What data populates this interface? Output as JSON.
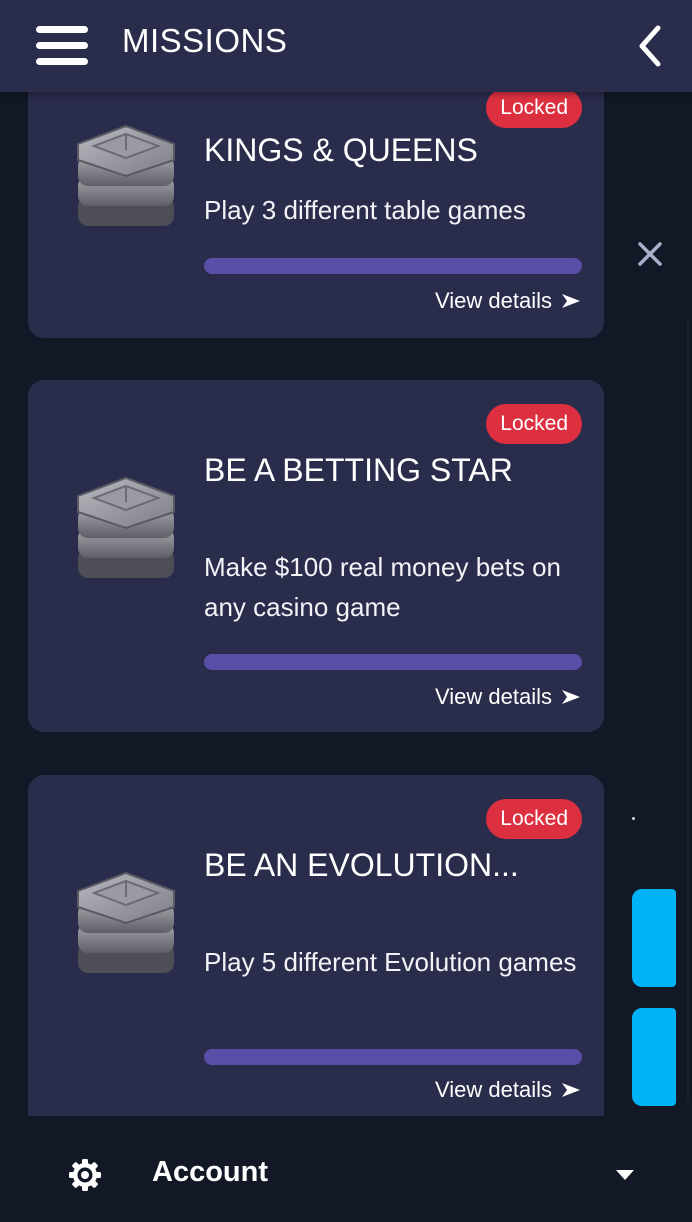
{
  "header": {
    "title": "MISSIONS"
  },
  "missions": [
    {
      "status": "Locked",
      "title": "KINGS & QUEENS",
      "description": "Play 3 different table games",
      "progress": 0,
      "action": "View details"
    },
    {
      "status": "Locked",
      "title": "BE A BETTING STAR",
      "description": "Make $100 real money bets on any casino game",
      "progress": 0,
      "action": "View details"
    },
    {
      "status": "Locked",
      "title": "BE AN EVOLUTION...",
      "description": "Play 5 different Evolution games",
      "progress": 0,
      "action": "View details"
    }
  ],
  "footer": {
    "account_label": "Account"
  },
  "icons": {
    "menu": "hamburger-menu-icon",
    "back": "chevron-left-icon",
    "close": "close-icon",
    "mission": "stacked-stone-icon",
    "settings": "gear-icon",
    "dropdown": "caret-down-icon",
    "arrow": "arrow-right-icon"
  },
  "colors": {
    "background": "#121826",
    "header": "#2a2c4b",
    "card": "#2a2c4b",
    "badge": "#dc3040",
    "progress": "#5a4fa8",
    "accent_tab": "#00b2f6"
  }
}
